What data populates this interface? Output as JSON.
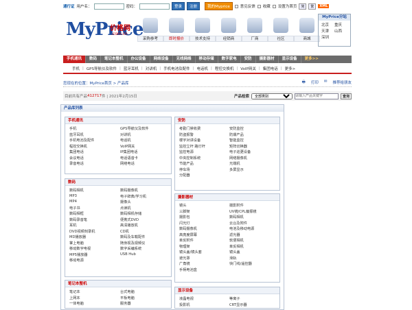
{
  "topbar": {
    "pass_label": "通行证",
    "user_label": "用户名：",
    "pwd_label": "密码：",
    "login": "登录",
    "register": "注册",
    "promo": "我的Myprice",
    "opt1": "意见反馈",
    "opt2": "收藏",
    "opt3": "设置为首页",
    "xml": "XML"
  },
  "logo": {
    "brand": "MyPrice",
    "cn": "价格网",
    "domain": ".com.cn"
  },
  "nav": [
    {
      "label": "采购参考",
      "icon": "chart-icon"
    },
    {
      "label": "即时报价",
      "icon": "calendar-icon"
    },
    {
      "label": "技术支持",
      "icon": "tools-icon"
    },
    {
      "label": "经销商",
      "icon": "dealer-icon"
    },
    {
      "label": "厂商",
      "icon": "factory-icon"
    },
    {
      "label": "社区",
      "icon": "community-icon"
    },
    {
      "label": "商城",
      "icon": "mall-icon"
    }
  ],
  "sidebox": {
    "title": "MyPrice分站",
    "cities": [
      "北京",
      "重庆",
      "天津",
      "山西",
      "深圳",
      ""
    ]
  },
  "categories": [
    "手机通讯",
    "数码",
    "笔记本整机",
    "办公设备",
    "网络设备",
    "无线网络",
    "移动存储",
    "数字家电",
    "安防",
    "摄影器材",
    "显示设备",
    "更多>>"
  ],
  "subcats": [
    "手机",
    "GPS导航仪及软件",
    "蓝牙耳机",
    "对讲机",
    "手机电池及配件",
    "电话机",
    "程控交换机",
    "VoIP网关",
    "集团电话",
    "更多>"
  ],
  "crumb": {
    "label": "您现在的位置：",
    "path": "MyPrice首页 > 产品库",
    "print": "打印",
    "fav": "推荐给朋友"
  },
  "stat": {
    "prefix": "目前共有产品",
    "count": "412717",
    "suffix": "件 | 2021年2月15日",
    "search_label": "产品检索",
    "select": "全部类别",
    "placeholder": "请输入产品关键字",
    "go": "查询"
  },
  "panel_title": "产品库列表",
  "boxes": [
    {
      "title": "手机通讯",
      "items": [
        "手机",
        "GPS导航仪及软件",
        "蓝牙耳机",
        "对讲机",
        "手机电池及配件",
        "电话机",
        "程控交换机",
        "VoIP网关",
        "集团电话",
        "IP集团电话",
        "会议电话",
        "电话语音卡",
        "录音电话",
        "网络电话"
      ]
    },
    {
      "title": "数码",
      "items": [
        "数码相机",
        "数码摄像机",
        "MP3",
        "电子辞典/学习机",
        "MP4",
        "摄像头",
        "电子书",
        "点读机",
        "数码相框",
        "数码相机存储",
        "数码录音笔",
        "便携式DVD",
        "耳机",
        "高清播放机",
        "DVD视频刻录机",
        "CD机",
        "MD播放器",
        "数码及车载配件",
        "掌上电脑",
        "随身视及视频仪",
        "移动数字电视",
        "数字采编系统",
        "MP5播放器",
        "USB Hub",
        "移动电源",
        ""
      ]
    },
    {
      "title": "笔记本整机",
      "items": [
        "笔记本",
        "台式电脑",
        "上网本",
        "平板电脑",
        "一体电脑",
        "服务器"
      ]
    },
    {
      "title": "安防",
      "items": [
        "考勤门禁收费",
        "安防监控",
        "防盗报警",
        "防爆产品",
        "楼宇对讲设备",
        "智能监控",
        "监控立杆 路灯杆",
        "矩阵切换器",
        "监控电源",
        "电子巡更设备",
        "中央控制系统",
        "网络摄像机",
        "节能产品",
        "光端机",
        "停车场",
        "多屏显示",
        "分配器",
        ""
      ]
    },
    {
      "title": "摄影器材",
      "items": [
        "镜头",
        "摄影附件",
        "三脚架",
        "UV镜/CPL偏振镜",
        "摄影包",
        "数码相机",
        "闪光灯",
        "云台及附件",
        "数码摄像机",
        "电池及移动电源",
        "高亮度屏幕",
        "滤光器",
        "单反附件",
        "软便相机",
        "物理架",
        "单反相机",
        "镜头盖/镜头套",
        "镜头盖",
        "遮光罩",
        "滑轨",
        "广角镜",
        "快门线/遥控器",
        "手柄电池盒",
        ""
      ]
    },
    {
      "title": "显示设备",
      "items": [
        "液晶电视",
        "等离子",
        "投影机",
        "CRT显示器"
      ]
    }
  ]
}
